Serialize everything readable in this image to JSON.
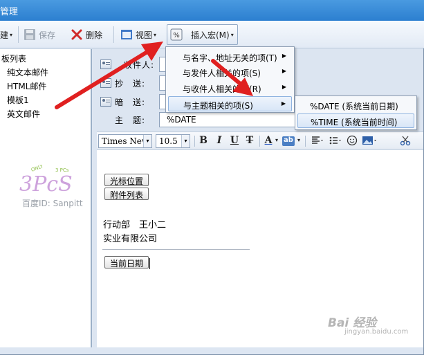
{
  "window": {
    "title": "管理"
  },
  "toolbar": {
    "new_label": "建",
    "save_label": "保存",
    "delete_label": "删除",
    "view_label": "视图",
    "macro_label": "插入宏(M)"
  },
  "tree": {
    "root": "板列表",
    "items": [
      "纯文本邮件",
      "HTML邮件",
      "模板1",
      "英文邮件"
    ]
  },
  "headers": {
    "to_label": "收件人:",
    "cc_label": "抄　送:",
    "bcc_label": "暗　送:",
    "subject_label": "主　题:",
    "subject_value": "%DATE"
  },
  "format_bar": {
    "font": "Times New Roman",
    "size": "10.5",
    "bold": "B",
    "italic": "I",
    "underline": "U",
    "strike": "T",
    "font_color": "A",
    "highlight": "ab"
  },
  "menu": {
    "items": [
      {
        "label": "与名字、地址无关的项(T)"
      },
      {
        "label": "与发件人相关的项(S)"
      },
      {
        "label": "与收件人相关的项(R)"
      },
      {
        "label": "与主题相关的项(S)"
      }
    ],
    "submenu": [
      {
        "label": "%DATE (系统当前日期)"
      },
      {
        "label": "%TIME (系统当前时间)"
      }
    ]
  },
  "editor": {
    "tag_cursor": "光标位置",
    "tag_attachments": "附件列表",
    "line1": "行动部　王小二",
    "line2": "实业有限公司",
    "tag_date": "当前日期"
  },
  "watermarks": {
    "left_top": "ONLY",
    "left_pcs": "3 PCs",
    "left_brand": "3PcS",
    "left_id": "百度ID: Sanpitt",
    "br_main": "Bai 经验",
    "br_sub": "jingyan.baidu.com"
  },
  "colors": {
    "annotation_arrow": "#e02020",
    "titlebar": "#2c7fd0"
  }
}
